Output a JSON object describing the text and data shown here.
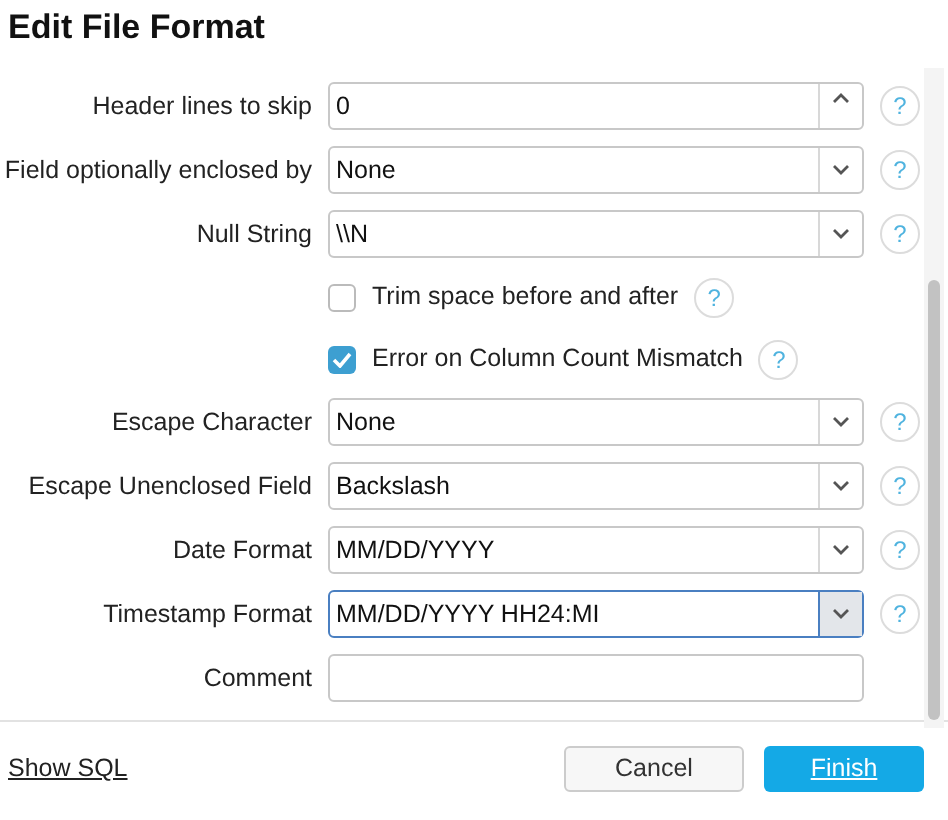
{
  "title": "Edit File Format",
  "fields": [
    {
      "kind": "number",
      "label": "Header lines to skip",
      "value": "0",
      "help": "?"
    },
    {
      "kind": "select",
      "label": "Field optionally enclosed by",
      "value": "None",
      "focused": false,
      "help": "?"
    },
    {
      "kind": "select",
      "label": "Null String",
      "value": "\\\\N",
      "focused": false,
      "help": "?"
    },
    {
      "kind": "checkbox",
      "label": "Trim space before and after",
      "checked": false,
      "help": "?"
    },
    {
      "kind": "checkbox",
      "label": "Error on Column Count Mismatch",
      "checked": true,
      "help": "?"
    },
    {
      "kind": "select",
      "label": "Escape Character",
      "value": "None",
      "focused": false,
      "help": "?"
    },
    {
      "kind": "select",
      "label": "Escape Unenclosed Field",
      "value": "Backslash",
      "focused": false,
      "help": "?"
    },
    {
      "kind": "select",
      "label": "Date Format",
      "value": "MM/DD/YYYY",
      "focused": false,
      "help": "?"
    },
    {
      "kind": "select",
      "label": "Timestamp Format",
      "value": "MM/DD/YYYY HH24:MI",
      "focused": true,
      "help": "?"
    },
    {
      "kind": "text",
      "label": "Comment"
    }
  ],
  "footer": {
    "link": "Show SQL",
    "cancel": "Cancel",
    "finish": "Finish"
  }
}
